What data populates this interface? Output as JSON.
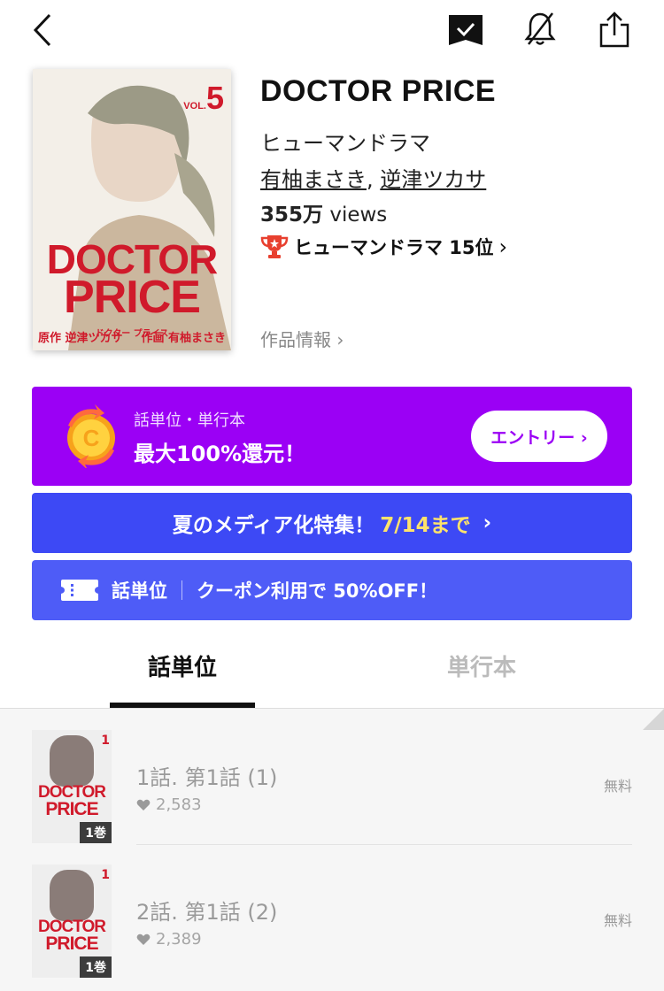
{
  "nav": {
    "back_icon": "chevron-left-icon",
    "bookmark_icon": "bookmark-check-icon",
    "bell_icon": "bell-off-icon",
    "share_icon": "share-icon"
  },
  "cover": {
    "vol_prefix": "VOL.",
    "vol_number": "5",
    "logo_line1": "DOCTOR",
    "logo_line2": "PRICE",
    "kana": "ドクター プライス",
    "credit_left": "原作 逆津ツカサ",
    "credit_right": "作画 有柚まさき"
  },
  "work": {
    "title": "DOCTOR PRICE",
    "genre": "ヒューマンドラマ",
    "author1": "有柚まさき",
    "author_sep": ",",
    "author2": "逆津ツカサ",
    "views_num": "355万",
    "views_unit": "views",
    "rank_text": "ヒューマンドラマ 15位",
    "rank_chevron": "›",
    "info_link": "作品情報 ›"
  },
  "banners": {
    "campaign": {
      "line1": "話単位・単行本",
      "line2": "最大100%還元！",
      "entry_label": "エントリー ›",
      "color": "#9b00f5"
    },
    "feature": {
      "text": "夏のメディア化特集！",
      "highlight": "7/14まで",
      "chevron": "›",
      "color": "#3d49f5"
    },
    "coupon": {
      "left": "話単位",
      "right": "クーポン利用で 50%OFF！",
      "color": "#4e5cf7"
    }
  },
  "tabs": [
    {
      "label": "話単位",
      "active": true
    },
    {
      "label": "単行本",
      "active": false
    }
  ],
  "episodes": [
    {
      "title": "1話. 第1話 (1)",
      "likes": "2,583",
      "price": "無料",
      "thumb_badge": "1巻",
      "thumb_vol": "1",
      "thumb_logo1": "DOCTOR",
      "thumb_logo2": "PRICE"
    },
    {
      "title": "2話. 第1話 (2)",
      "likes": "2,389",
      "price": "無料",
      "thumb_badge": "1巻",
      "thumb_vol": "1",
      "thumb_logo1": "DOCTOR",
      "thumb_logo2": "PRICE"
    }
  ]
}
